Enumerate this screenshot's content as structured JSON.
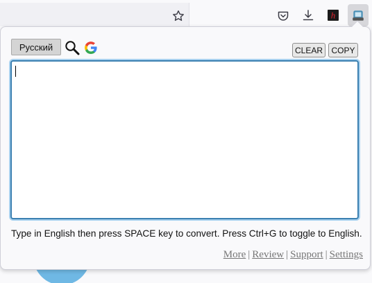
{
  "browser_toolbar": {
    "icons": {
      "bookmark": "star-icon",
      "pocket": "pocket-icon",
      "downloads": "download-icon",
      "extension": "h-extension-icon",
      "active_extension": "translit-extension-icon"
    },
    "extension_badge": "h"
  },
  "popup": {
    "language_button": "Русский",
    "clear_button": "CLEAR",
    "copy_button": "COPY",
    "input_value": "",
    "hint": "Type in English then press SPACE key to convert. Press Ctrl+G to toggle to English.",
    "links": {
      "more": "More",
      "review": "Review",
      "support": "Support",
      "settings": "Settings",
      "separator": "|"
    }
  },
  "colors": {
    "textarea_border": "#3a7fb0",
    "textarea_glow": "#a9d2ef",
    "red_extension": "#c8102e"
  }
}
